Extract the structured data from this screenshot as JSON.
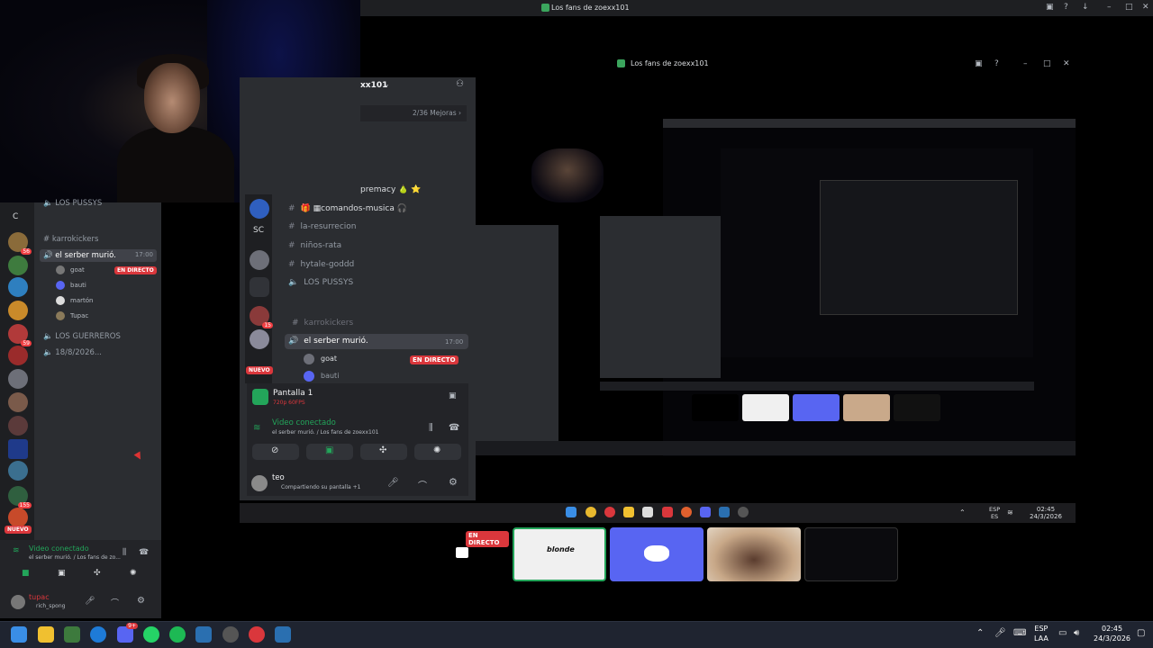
{
  "outer_window": {
    "title": "Los fans de zoexx101"
  },
  "stream_window": {
    "title": "Los fans de zoexx101"
  },
  "left_sidebar": {
    "server_initial": "C",
    "category_partial": "LOS PUSSYS",
    "channels": [
      {
        "name": "karrokickers",
        "type": "text"
      },
      {
        "name": "el serber murió.",
        "type": "voice",
        "active": true,
        "time": "17:00"
      },
      {
        "name": "LOS GUERREROS",
        "type": "voice"
      },
      {
        "name": "18/8/2026...",
        "type": "voice"
      }
    ],
    "voice_users": [
      {
        "name": "goat",
        "badge": "EN DIRECTO"
      },
      {
        "name": "bauti"
      },
      {
        "name": "martón"
      },
      {
        "name": "Tupac"
      }
    ],
    "new_badge": "NUEVO",
    "server_badges": [
      "56",
      "59",
      "155"
    ],
    "voice_panel": {
      "status": "Video conectado",
      "subtitle": "el serber murió. / Los fans de zo..."
    },
    "user_panel": {
      "name": "tupac",
      "status": "rich_spong"
    }
  },
  "inner_discord": {
    "server_name": "xx101",
    "boost_text": "2/36 Mejoras",
    "partial_channel": "premacy",
    "server_rail_labels": [
      "SC"
    ],
    "new_badge": "NUEVO",
    "rail_badge": "15",
    "channels": [
      {
        "name": "comandos-musica",
        "type": "text"
      },
      {
        "name": "la-resurrecion",
        "type": "text"
      },
      {
        "name": "niños-rata",
        "type": "text"
      },
      {
        "name": "hytale-goddd",
        "type": "text"
      },
      {
        "name": "LOS PUSSYS",
        "type": "voice"
      },
      {
        "name": "karrokickers",
        "type": "text"
      },
      {
        "name": "el serber murió.",
        "type": "voice",
        "active": true,
        "time": "17:00"
      }
    ],
    "voice_users": [
      {
        "name": "goat",
        "badge": "EN DIRECTO"
      },
      {
        "name": "bauti"
      }
    ],
    "stream_panel": {
      "title": "Pantalla 1",
      "quality": "720p 60FPS"
    },
    "voice_panel": {
      "status": "Video conectado",
      "subtitle": "el serber murió. / Los fans de zoexx101"
    },
    "user_panel": {
      "name": "teo",
      "status": "Compartiendo su pantalla +1"
    }
  },
  "mid_taskbar": {
    "lang_top": "ESP",
    "lang_bottom": "ES",
    "time": "02:45",
    "date": "24/3/2026"
  },
  "previews": [
    {
      "name": "screen",
      "badge": "EN DIRECTO"
    },
    {
      "name": "blonde",
      "text": "blonde"
    },
    {
      "name": "discord"
    },
    {
      "name": "webcam"
    },
    {
      "name": "desktop"
    }
  ],
  "taskbar": {
    "lang_top": "ESP",
    "lang_bottom": "LAA",
    "time": "02:45",
    "date": "24/3/2026",
    "discord_badge": "9+",
    "colors": {
      "bg": "#1f2430",
      "discord": "#5865f2",
      "live": "#da373c",
      "green": "#23a55a"
    }
  }
}
